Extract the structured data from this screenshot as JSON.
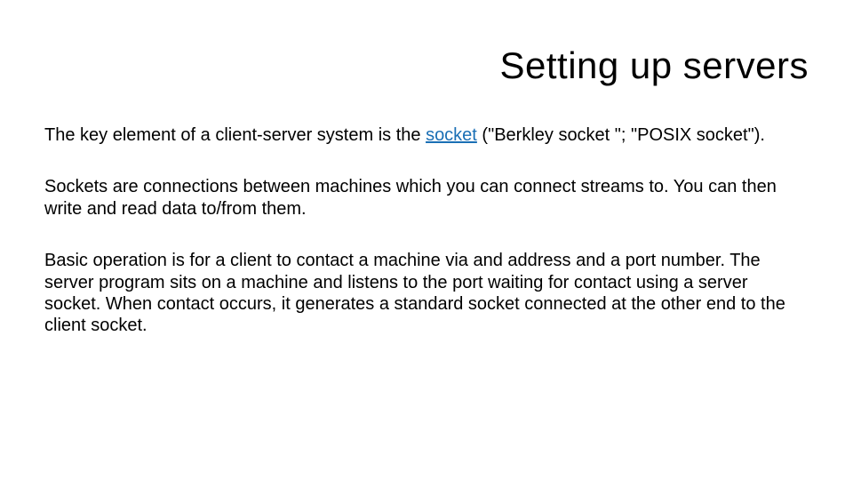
{
  "slide": {
    "title": "Setting up servers",
    "para1_pre": "The key element of a client-server system is the ",
    "para1_link": "socket",
    "para1_post": " (\"Berkley socket \"; \"POSIX socket\").",
    "para2": "Sockets are connections between machines which you can connect streams to. You can then write and read data to/from them.",
    "para3": "Basic operation is for a client to contact a machine via and address and a port number. The server program sits on a machine and listens to the port waiting for contact using a server socket. When contact occurs, it generates a standard socket connected at the other end to the client socket."
  }
}
